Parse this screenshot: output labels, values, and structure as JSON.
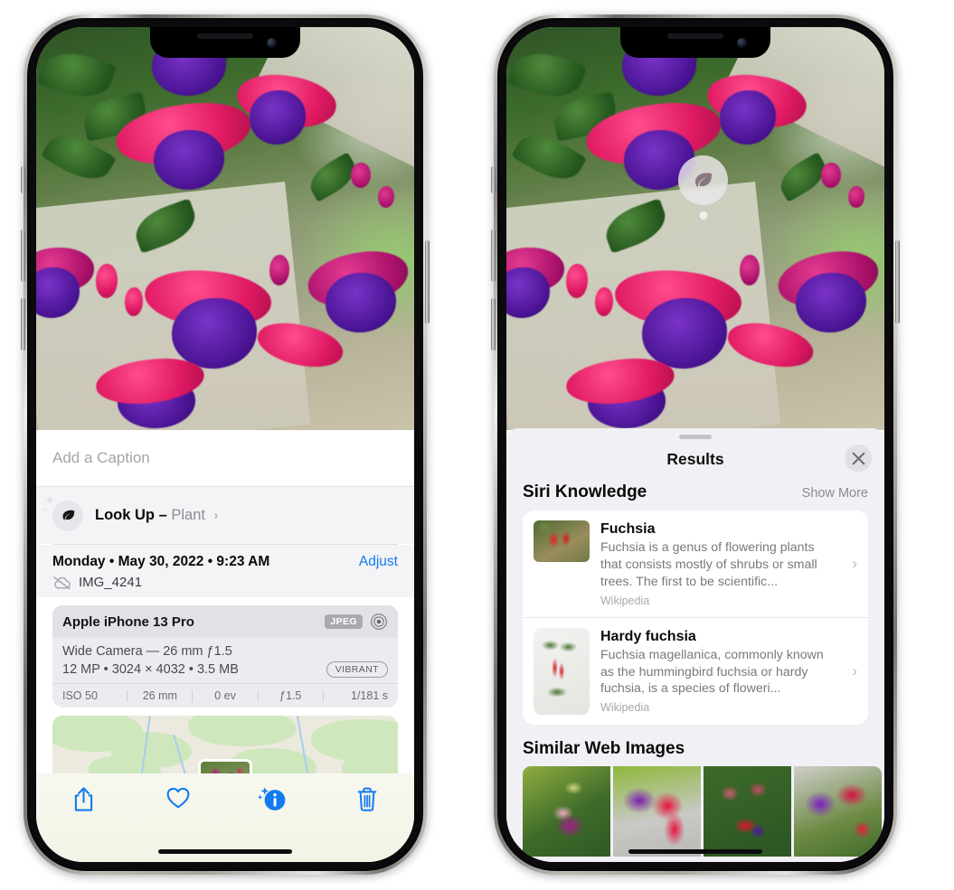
{
  "left_phone": {
    "caption_placeholder": "Add a Caption",
    "lookup": {
      "label": "Look Up –",
      "subject": "Plant",
      "chevron": "›",
      "icon": "leaf-icon"
    },
    "meta": {
      "date": "Monday • May 30, 2022 • 9:23 AM",
      "adjust_label": "Adjust",
      "filename": "IMG_4241",
      "cloud_icon": "cloud-slash-icon"
    },
    "camera_card": {
      "device": "Apple iPhone 13 Pro",
      "format_badge": "JPEG",
      "lens_icon": "aperture-icon",
      "lens_line": "Wide Camera — 26 mm ƒ1.5",
      "specs_line": "12 MP • 3024 × 4032 • 3.5 MB",
      "style_badge": "VIBRANT",
      "exif": [
        "ISO 50",
        "26 mm",
        "0 ev",
        "ƒ1.5",
        "1/181 s"
      ]
    },
    "toolbar": [
      {
        "name": "share-button",
        "icon": "share-icon"
      },
      {
        "name": "favorite-button",
        "icon": "heart-icon"
      },
      {
        "name": "info-button",
        "icon": "info-sparkle-icon"
      },
      {
        "name": "delete-button",
        "icon": "trash-icon"
      }
    ],
    "accent_color": "#127bf2"
  },
  "right_phone": {
    "visual_lookup_pin": {
      "icon": "leaf-icon"
    },
    "sheet": {
      "title": "Results",
      "close_icon": "close-icon",
      "siri_knowledge": {
        "title": "Siri Knowledge",
        "show_more": "Show More",
        "results": [
          {
            "title": "Fuchsia",
            "description": "Fuchsia is a genus of flowering plants that consists mostly of shrubs or small trees. The first to be scientific...",
            "source": "Wikipedia",
            "chevron": "›"
          },
          {
            "title": "Hardy fuchsia",
            "description": "Fuchsia magellanica, commonly known as the hummingbird fuchsia or hardy fuchsia, is a species of floweri...",
            "source": "Wikipedia",
            "chevron": "›"
          }
        ]
      },
      "similar_web_images": {
        "title": "Similar Web Images",
        "count": 4
      }
    }
  }
}
